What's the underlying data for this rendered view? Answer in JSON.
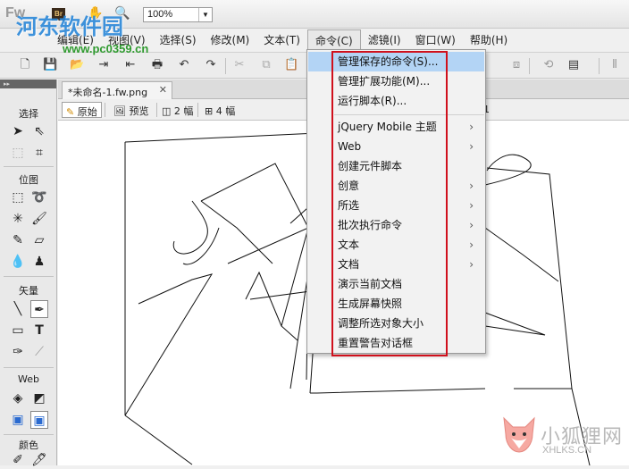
{
  "titlebar": {
    "app_logo": "Fw",
    "br_badge": "Br",
    "zoom_value": "100%"
  },
  "menubar": {
    "items": [
      "编辑(E)",
      "视图(V)",
      "选择(S)",
      "修改(M)",
      "文本(T)",
      "命令(C)",
      "滤镜(I)",
      "窗口(W)",
      "帮助(H)"
    ],
    "file_label": "文件(F)"
  },
  "tools": {
    "sections": {
      "select": "选择",
      "bitmap": "位图",
      "vector": "矢量",
      "web": "Web",
      "colors": "颜色"
    }
  },
  "document": {
    "tab_title": "*未命名-1.fw.png",
    "view_buttons": {
      "original": "原始",
      "preview": "预览",
      "two_up": "2 幅",
      "four_up": "4 幅"
    },
    "page_indicator": "1"
  },
  "commands_menu": {
    "items": [
      {
        "label": "管理保存的命令(S)...",
        "submenu": false
      },
      {
        "label": "管理扩展功能(M)...",
        "submenu": false
      },
      {
        "label": "运行脚本(R)...",
        "submenu": false
      },
      {
        "label": "jQuery Mobile 主题",
        "submenu": true
      },
      {
        "label": "Web",
        "submenu": true
      },
      {
        "label": "创建元件脚本",
        "submenu": false
      },
      {
        "label": "创意",
        "submenu": true
      },
      {
        "label": "所选",
        "submenu": true
      },
      {
        "label": "批次执行命令",
        "submenu": true
      },
      {
        "label": "文本",
        "submenu": true
      },
      {
        "label": "文档",
        "submenu": true
      },
      {
        "label": "演示当前文档",
        "submenu": false
      },
      {
        "label": "生成屏幕快照",
        "submenu": false
      },
      {
        "label": "调整所选对象大小",
        "submenu": false
      },
      {
        "label": "重置警告对话框",
        "submenu": false
      }
    ]
  },
  "watermarks": {
    "site_cn": "河东软件园",
    "site_url": "www.pc0359.cn",
    "fox_cn": "小狐狸网",
    "fox_url": "XHLKS.CN"
  },
  "colors": {
    "highlight": "#b3d4f5",
    "red_box": "#d0101c",
    "watermark_blue": "#2b88d9",
    "watermark_green": "#2f9a2f"
  }
}
